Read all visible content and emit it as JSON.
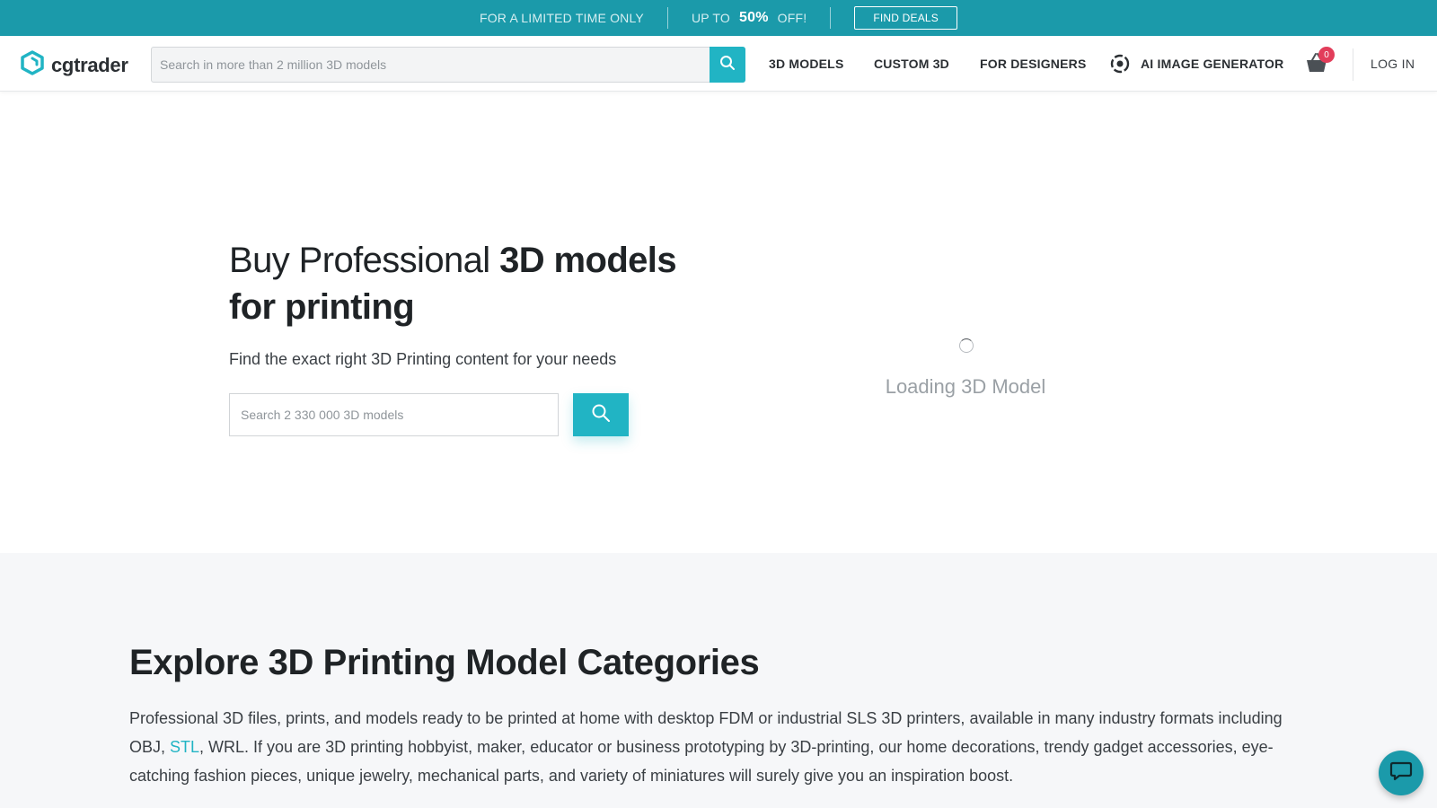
{
  "promo": {
    "limited": "FOR A LIMITED TIME ONLY",
    "upto": "UP TO",
    "percent": "50%",
    "off": "OFF!",
    "deals_button": "FIND DEALS"
  },
  "header": {
    "logo_text": "cgtrader",
    "search_placeholder": "Search in more than 2 million 3D models",
    "nav": {
      "models": "3D MODELS",
      "custom": "CUSTOM 3D",
      "designers": "FOR DESIGNERS",
      "ai": "AI IMAGE GENERATOR"
    },
    "cart_count": "0",
    "login": "LOG IN"
  },
  "hero": {
    "title_regular": "Buy Professional ",
    "title_bold_1": "3D models",
    "title_bold_2": "for printing",
    "subtitle": "Find the exact right 3D Printing content for your needs",
    "search_placeholder": "Search 2 330 000 3D models",
    "loading_text": "Loading 3D Model"
  },
  "explore": {
    "title_regular": "Explore 3D Printing Model ",
    "title_bold": "Categories",
    "text_1": "Professional 3D files, prints, and models ready to be printed at home with desktop FDM or industrial SLS 3D printers, available in many industry formats including OBJ, ",
    "link": "STL",
    "text_2": ", WRL. If you are 3D printing hobbyist, maker, educator or business prototyping by 3D-printing, our home decorations, trendy gadget accessories, eye-catching fashion pieces, unique jewelry, mechanical parts, and variety of miniatures will surely give you an inspiration boost."
  },
  "colors": {
    "brand_teal": "#21b4c4",
    "promo_bar": "#1b9aaa",
    "badge_red": "#e23d5a"
  },
  "icons": [
    "logo-hexagon-icon",
    "search-icon",
    "ai-aperture-icon",
    "cart-basket-icon",
    "chat-icon",
    "spinner-icon"
  ]
}
